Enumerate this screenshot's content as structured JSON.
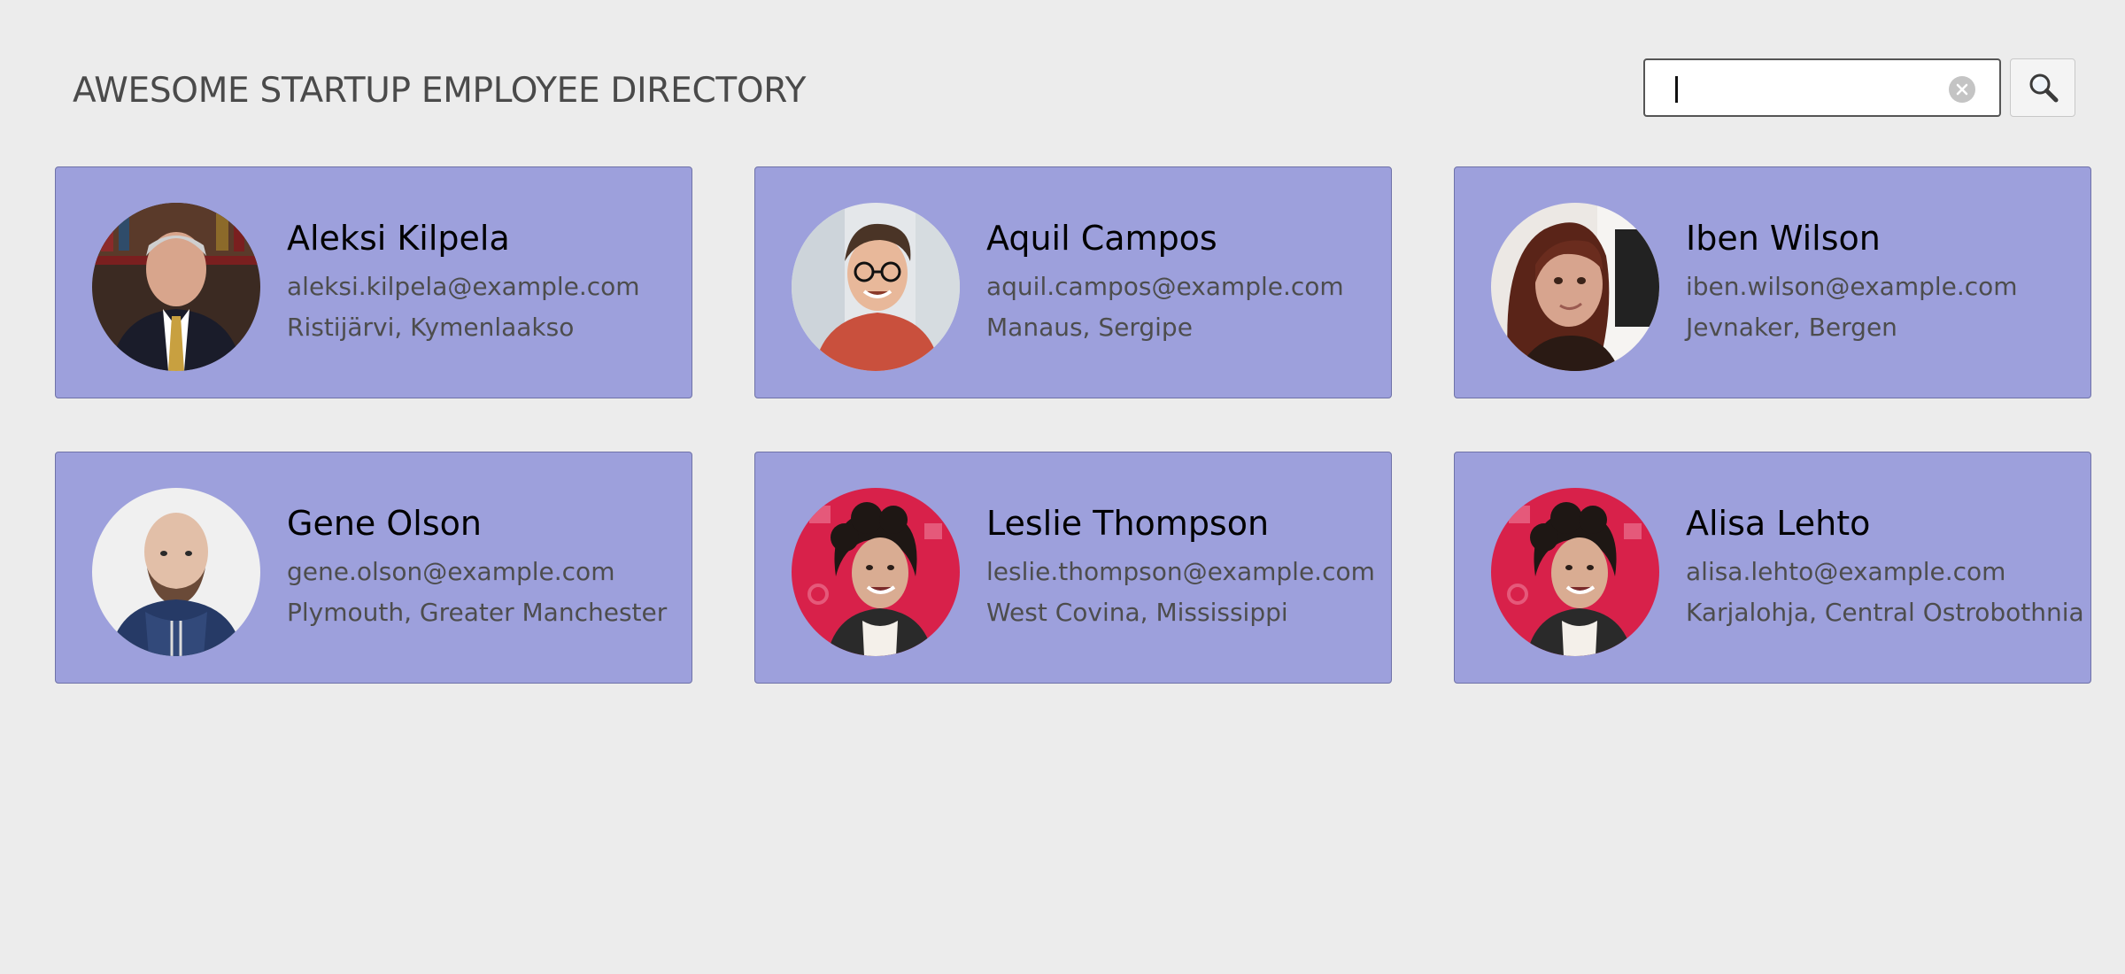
{
  "header": {
    "title": "AWESOME STARTUP EMPLOYEE DIRECTORY"
  },
  "search": {
    "value": "",
    "placeholder": "",
    "clear_icon": "clear-circle-icon",
    "search_icon": "magnifier-icon"
  },
  "colors": {
    "background": "#ececec",
    "card": "#9da0dc",
    "card_border": "#6f72a8"
  },
  "employees": [
    {
      "name": "Aleksi Kilpela",
      "email": "aleksi.kilpela@example.com",
      "location": "Ristijärvi, Kymenlaakso"
    },
    {
      "name": "Aquil Campos",
      "email": "aquil.campos@example.com",
      "location": "Manaus, Sergipe"
    },
    {
      "name": "Iben Wilson",
      "email": "iben.wilson@example.com",
      "location": "Jevnaker, Bergen"
    },
    {
      "name": "Gene Olson",
      "email": "gene.olson@example.com",
      "location": "Plymouth, Greater Manchester"
    },
    {
      "name": "Leslie Thompson",
      "email": "leslie.thompson@example.com",
      "location": "West Covina, Mississippi"
    },
    {
      "name": "Alisa Lehto",
      "email": "alisa.lehto@example.com",
      "location": "Karjalohja, Central Ostrobothnia"
    }
  ]
}
